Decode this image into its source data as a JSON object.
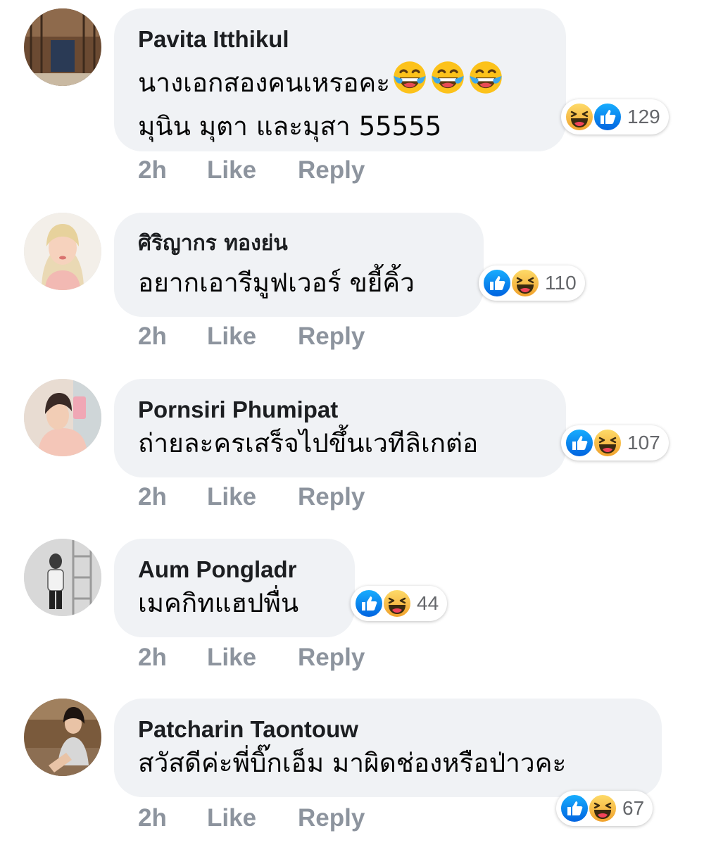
{
  "comments": [
    {
      "author": "Pavita Itthikul",
      "lines": [
        "นางเอกสองคนเหรอคะ",
        "มุนิน มุตา และมุสา 55555"
      ],
      "inline_emoji": [
        "face-with-tears-of-joy-icon",
        "face-with-tears-of-joy-icon",
        "face-with-tears-of-joy-icon"
      ],
      "reactions": [
        "haha",
        "like"
      ],
      "reaction_count": "129",
      "time": "2h",
      "like_label": "Like",
      "reply_label": "Reply"
    },
    {
      "author": "ศิริญากร ทองย่น",
      "lines": [
        "อยากเอารีมูฟเวอร์ ขยี้คิ้ว"
      ],
      "reactions": [
        "like",
        "haha"
      ],
      "reaction_count": "110",
      "time": "2h",
      "like_label": "Like",
      "reply_label": "Reply"
    },
    {
      "author": "Pornsiri Phumipat",
      "lines": [
        "ถ่ายละครเสร็จไปขึ้นเวทีลิเกต่อ"
      ],
      "reactions": [
        "like",
        "haha"
      ],
      "reaction_count": "107",
      "time": "2h",
      "like_label": "Like",
      "reply_label": "Reply"
    },
    {
      "author": "Aum Pongladr",
      "lines": [
        "เมคกิทแฮปพื่น"
      ],
      "reactions": [
        "like",
        "haha"
      ],
      "reaction_count": "44",
      "time": "2h",
      "like_label": "Like",
      "reply_label": "Reply"
    },
    {
      "author": "Patcharin Taontouw",
      "lines": [
        "สวัสดีค่ะพี่บิ๊กเอ็ม มาผิดช่องหรือป่าวคะ"
      ],
      "reactions": [
        "like",
        "haha"
      ],
      "reaction_count": "67",
      "time": "2h",
      "like_label": "Like",
      "reply_label": "Reply"
    }
  ],
  "colors": {
    "bubble": "#f0f2f5",
    "like_blue": "#1877f2",
    "haha_yellow": "#f7b125",
    "meta_gray": "#8d949e"
  }
}
